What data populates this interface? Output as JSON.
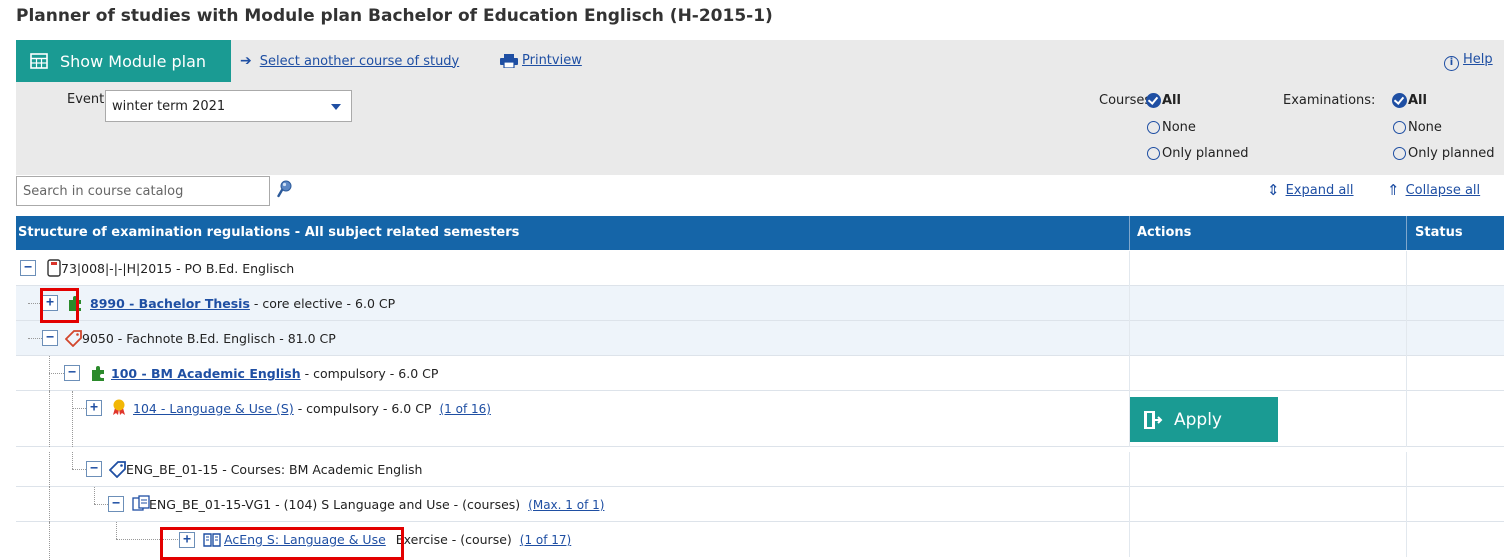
{
  "page": {
    "title": "Planner of studies with Module plan Bachelor of Education Englisch (H-2015-1)"
  },
  "toolbar": {
    "show_module_plan": "Show Module plan",
    "select_course": "Select another course of study",
    "printview": "Printview",
    "help": "Help"
  },
  "events": {
    "label": "Events",
    "selected": "winter term 2021"
  },
  "filters": {
    "courses_label": "Courses:",
    "examinations_label": "Examinations:",
    "options": [
      "All",
      "None",
      "Only planned"
    ],
    "courses_selected": "All",
    "examinations_selected": "All"
  },
  "search": {
    "placeholder": "Search in course catalog"
  },
  "tree_controls": {
    "expand_all": "Expand all",
    "collapse_all": "Collapse all"
  },
  "table": {
    "headers": {
      "structure": "Structure of examination regulations - All subject related semesters",
      "actions": "Actions",
      "status": "Status"
    },
    "rows": [
      {
        "toggle": "−",
        "code": "73|008|-|-|H|2015 - PO B.Ed. Englisch",
        "icon": "regulation-icon"
      },
      {
        "toggle": "+",
        "link": "8990 - Bachelor Thesis",
        "suffix": " - core elective - 6.0 CP",
        "icon": "puzzle-icon"
      },
      {
        "toggle": "−",
        "code": "9050 - Fachnote B.Ed. Englisch - 81.0 CP",
        "icon": "tag-icon"
      },
      {
        "toggle": "−",
        "link": "100 - BM Academic English",
        "suffix": " - compulsory - 6.0 CP",
        "icon": "puzzle-icon"
      },
      {
        "toggle": "+",
        "link": "104 - Language & Use (S)",
        "suffix": " - compulsory - 6.0 CP",
        "count": "(1 of 16)",
        "icon": "award-icon"
      },
      {
        "toggle": "−",
        "code": "ENG_BE_01-15 - Courses: BM Academic English",
        "icon": "tag-icon"
      },
      {
        "toggle": "−",
        "code": "ENG_BE_01-15-VG1 - (104) S Language and Use - (courses)",
        "count": "(Max. 1 of 1)",
        "icon": "group-icon"
      },
      {
        "toggle": "+",
        "link": "AcEng S: Language & Use",
        "suffix": " Exercise - (course)",
        "count": "(1 of 17)",
        "icon": "book-icon"
      }
    ],
    "apply_button": "Apply"
  },
  "colors": {
    "teal": "#1a9b93",
    "header_blue": "#1565a8",
    "link_blue": "#1f4fa3",
    "highlight_red": "#e30000"
  }
}
